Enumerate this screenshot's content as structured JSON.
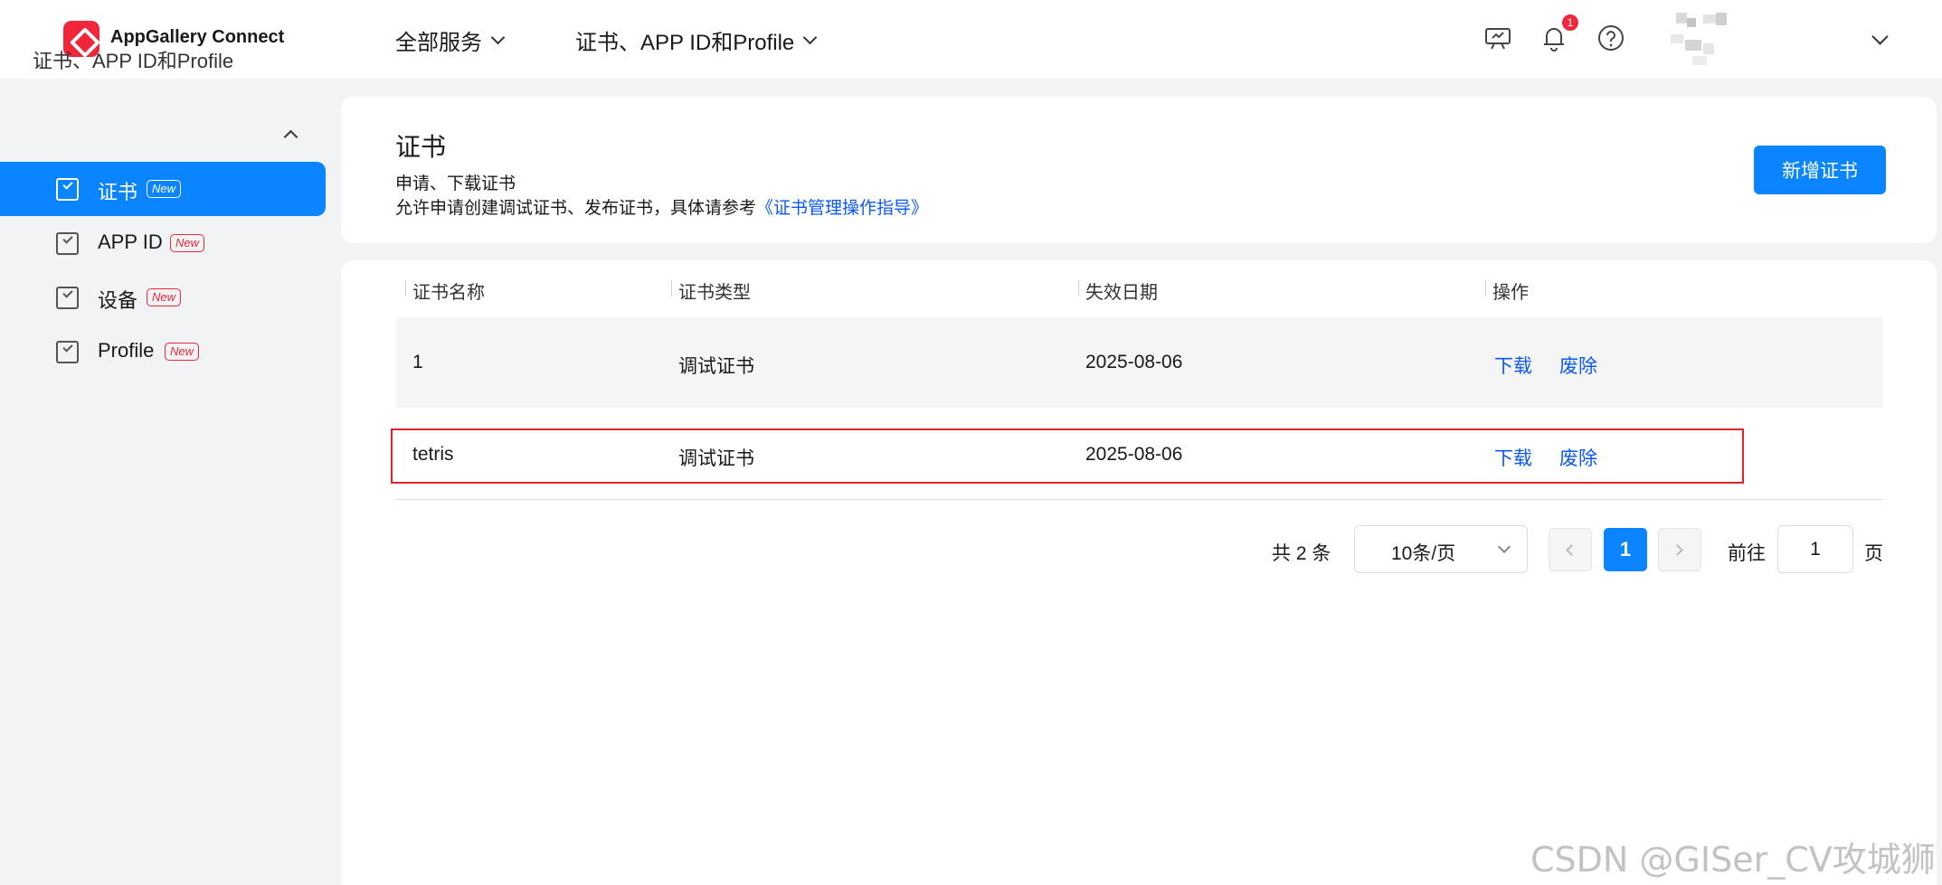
{
  "header": {
    "app_title": "AppGallery Connect",
    "nav": [
      "全部服务",
      "证书、APP ID和Profile"
    ],
    "notification_count": "1"
  },
  "sidebar": {
    "group_label": "证书、APP ID和Profile",
    "new_tag": "New",
    "items": [
      {
        "label": "证书",
        "active": true
      },
      {
        "label": "APP ID"
      },
      {
        "label": "设备"
      },
      {
        "label": "Profile"
      }
    ]
  },
  "page": {
    "title": "证书",
    "subtitle": "申请、下载证书",
    "description": "允许申请创建调试证书、发布证书，具体请参考",
    "guide_link": "《证书管理操作指导》",
    "add_button": "新增证书"
  },
  "table": {
    "columns": [
      "证书名称",
      "证书类型",
      "失效日期",
      "操作"
    ],
    "rows": [
      {
        "name": "1",
        "type": "调试证书",
        "expiry": "2025-08-06",
        "actions": [
          "下载",
          "废除"
        ]
      },
      {
        "name": "tetris",
        "type": "调试证书",
        "expiry": "2025-08-06",
        "actions": [
          "下载",
          "废除"
        ]
      }
    ]
  },
  "pagination": {
    "total": "共 2 条",
    "page_size": "10条/页",
    "current_page": "1",
    "goto_label": "前往",
    "goto_value": "1",
    "goto_suffix": "页"
  },
  "watermark": "CSDN @GISer_CV攻城狮",
  "colors": {
    "accent": "#0a84ff",
    "link": "#0a59f7",
    "brand_red": "#f0263b",
    "highlight_box": "#e0242e"
  }
}
